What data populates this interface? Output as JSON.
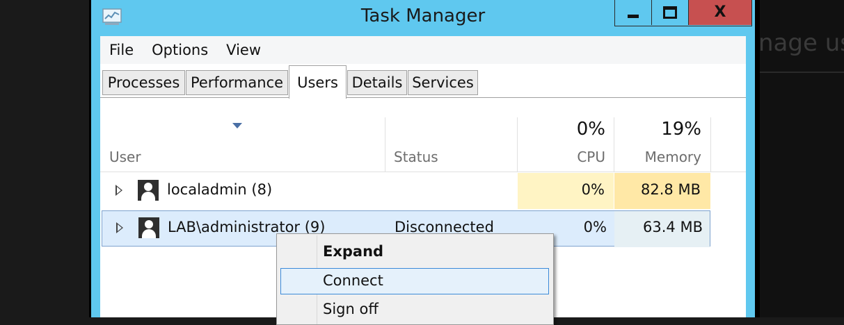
{
  "background_window": {
    "partial_text": "nage use"
  },
  "window": {
    "title": "Task Manager",
    "close_glyph": "X",
    "accent": "#5fc8ef",
    "close_color": "#c75050"
  },
  "menu": [
    "File",
    "Options",
    "View"
  ],
  "tabs": [
    {
      "label": "Processes",
      "active": false
    },
    {
      "label": "Performance",
      "active": false
    },
    {
      "label": "Users",
      "active": true
    },
    {
      "label": "Details",
      "active": false
    },
    {
      "label": "Services",
      "active": false
    }
  ],
  "columns": {
    "user": "User",
    "status": "Status",
    "cpu": {
      "label": "CPU",
      "total": "0%"
    },
    "memory": {
      "label": "Memory",
      "total": "19%"
    }
  },
  "rows": [
    {
      "user": "localadmin (8)",
      "status": "",
      "cpu": "0%",
      "memory": "82.8 MB",
      "selected": false
    },
    {
      "user": "LAB\\administrator (9)",
      "status": "Disconnected",
      "cpu": "0%",
      "memory": "63.4 MB",
      "selected": true
    }
  ],
  "context_menu": {
    "items": [
      {
        "label": "Expand",
        "bold": true
      },
      {
        "label": "Connect",
        "hover": true
      },
      {
        "label": "Sign off"
      }
    ]
  }
}
